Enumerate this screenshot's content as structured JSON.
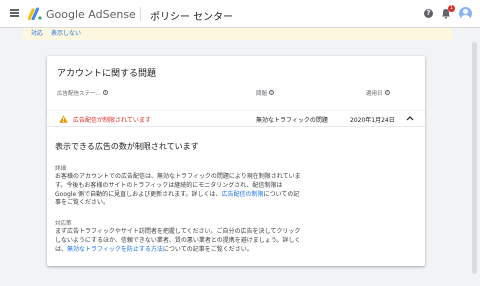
{
  "header": {
    "brand": "Google AdSense",
    "page_title": "ポリシー センター",
    "notification_count": "1"
  },
  "banner": {
    "links": [
      "対応",
      "表示しない"
    ]
  },
  "account_card": {
    "title": "アカウントに関する問題",
    "columns": [
      "広告配信ステー...",
      "問題",
      "適用日"
    ]
  },
  "issue_row": {
    "status": "広告配信が制限されています",
    "issue": "無効なトラフィックの問題",
    "date": "2020年1月24日"
  },
  "detail": {
    "title": "表示できる広告の数が制限されています",
    "details_label": "詳細",
    "details_text": "お客様のアカウントでの広告配信は、無効なトラフィックの問題により現在制限されています。今後もお客様のサイトのトラフィックは継続的にモニタリングされ、配信制限は Google 側で自動的に見直しおよび更新されます。詳しくは、",
    "details_link": "広告配信の制限",
    "details_suffix": "について",
    "details_tail": "の記事をご覧ください。",
    "action_label": "対応策",
    "action_text": "まず広告トラフィックやサイト訪問者を把握してください。ご自分の広告を決してクリックしないようにするほか、信頼できない業者、質の悪い業者との提携を避けましょう。詳しくは、",
    "action_link": "無効なトラフィックを防止する方法",
    "action_suffix": "についての記事をご覧ください。"
  },
  "colors": {
    "accent": "#1a73e8",
    "error": "#d93025",
    "warning": "#f29900"
  }
}
